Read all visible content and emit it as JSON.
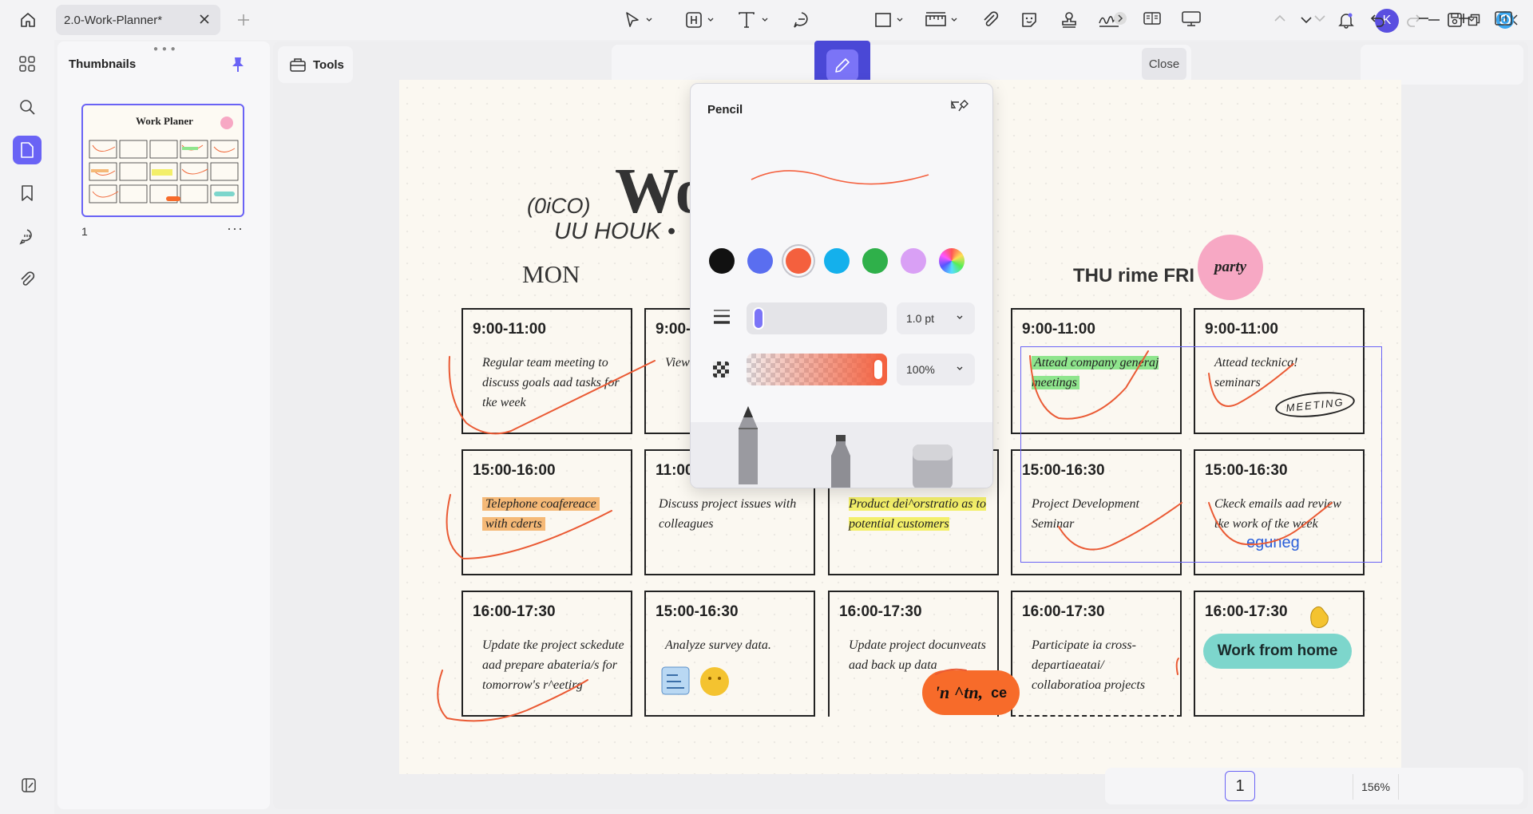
{
  "window": {
    "tab_title": "2.0-Work-Planner*",
    "avatar_letter": "K"
  },
  "thumbnails": {
    "title": "Thumbnails",
    "page_label": "1",
    "more": "···",
    "thumb_title": "Work Planer"
  },
  "toolbar": {
    "tools_label": "Tools",
    "close_label": "Close"
  },
  "pencil_popup": {
    "title": "Pencil",
    "colors": [
      "#111111",
      "#5a6ef0",
      "#f4603e",
      "#14b0ec",
      "#2fb04a",
      "#d9a0f5",
      "rainbow"
    ],
    "selected_color": "#f4603e",
    "thickness": "1.0 pt",
    "opacity": "100%",
    "tip_shapes": [
      "pencil",
      "marker",
      "eraser"
    ]
  },
  "planner": {
    "logo_small": "(0iCO)",
    "title_fragment": "Wo",
    "subtitle_fragment": "UU HOUK •",
    "days": {
      "mon": "MON",
      "thu_fri": "THU rime FRI"
    },
    "party_sticker": "party",
    "cells": [
      {
        "time": "9:00-11:00",
        "text": "Regular team meeting to discuss goals aad tasks for tke week"
      },
      {
        "time": "9:00-",
        "text": "View"
      },
      {
        "time": "9:00-11:00",
        "text": "Attead company generaj meetings"
      },
      {
        "time": "9:00-11:00",
        "text": "Attead tecknica! seminars"
      },
      {
        "time": "15:00-16:00",
        "text_1": "Telephone coafereace",
        "text_2": "with cderts"
      },
      {
        "time": "11:00",
        "text": "Discuss project issues with colleagues"
      },
      {
        "time": "",
        "text": "Product dei^orstratio as to potential customers"
      },
      {
        "time": "15:00-16:30",
        "text": "Project Development Seminar"
      },
      {
        "time": "15:00-16:30",
        "text": "Ckeck emails aad review tke work of tke week",
        "extra": "eguneg"
      },
      {
        "time": "16:00-17:30",
        "text": "Update tke project sckedute aad prepare abateria/s for tomorrow's r^eetirg"
      },
      {
        "time": "15:00-16:30",
        "text": "Analyze survey data."
      },
      {
        "time": "16:00-17:30",
        "text": "Update project docunveats aad back up data"
      },
      {
        "time": "16:00-17:30",
        "text": "Participate ia cross-departiaeatai/ collaboratioa projects"
      },
      {
        "time": "16:00-17:30",
        "badge": "Work from home"
      }
    ],
    "meeting_stamp": "MEETING",
    "blob_text_1": "'n ^tn,",
    "blob_text_2": "ce"
  },
  "bottom_bar": {
    "page_number": "1",
    "zoom": "156%"
  }
}
